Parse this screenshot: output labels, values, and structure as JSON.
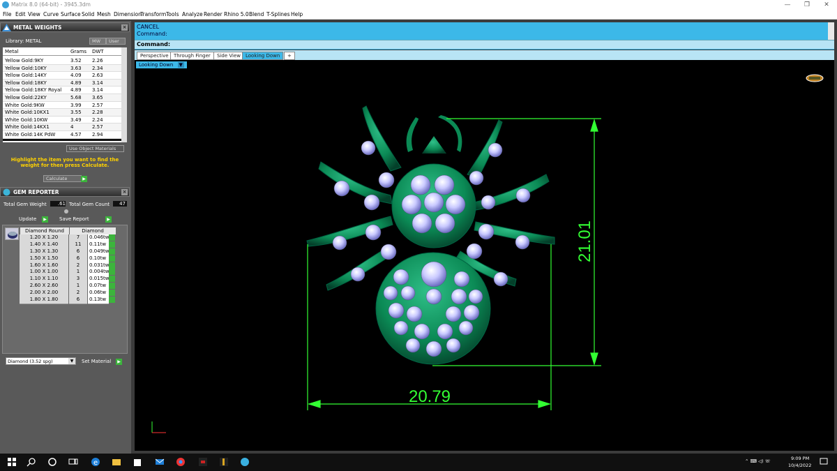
{
  "window": {
    "title": "Matrix 8.0 (64-bit) - 3945.3dm",
    "controls": [
      "—",
      "❐",
      "✕"
    ]
  },
  "menu": [
    "File",
    "Edit",
    "View",
    "Curve",
    "Surface",
    "Solid",
    "Mesh",
    "Dimension",
    "Transform",
    "Tools",
    "Analyze",
    "Render",
    "Rhino 5.0",
    "Blend",
    "T-Splines",
    "Help"
  ],
  "metal_weights": {
    "title": "METAL WEIGHTS",
    "library_label": "Library: METAL",
    "btn_mw": "MW",
    "btn_user": "User",
    "headers": [
      "Metal",
      "Grams",
      "DWT"
    ],
    "rows": [
      [
        "Yellow Gold:9KY",
        "3.52",
        "2.26"
      ],
      [
        "Yellow Gold:10KY",
        "3.63",
        "2.34"
      ],
      [
        "Yellow Gold:14KY",
        "4.09",
        "2.63"
      ],
      [
        "Yellow Gold:18KY",
        "4.89",
        "3.14"
      ],
      [
        "Yellow Gold:18KY Royal",
        "4.89",
        "3.14"
      ],
      [
        "Yellow Gold:22KY",
        "5.68",
        "3.65"
      ],
      [
        "White Gold:9KW",
        "3.99",
        "2.57"
      ],
      [
        "White Gold:10KX1",
        "3.55",
        "2.28"
      ],
      [
        "White Gold:10KW",
        "3.49",
        "2.24"
      ],
      [
        "White Gold:14KX1",
        "4",
        "2.57"
      ],
      [
        "White Gold:14K PdW",
        "4.57",
        "2.94"
      ]
    ],
    "use_object_materials": "Use Object Materials",
    "instruction": "Highlight the item you want to find the weight for then press Calculate.",
    "calculate": "Calculate"
  },
  "gem_reporter": {
    "title": "GEM REPORTER",
    "total_weight_label": "Total Gem Weight",
    "total_weight_value": ".61",
    "total_count_label": "Total Gem Count",
    "total_count_value": "47",
    "update": "Update",
    "save_report": "Save Report",
    "headers": [
      "Diamond Round",
      "Diamond"
    ],
    "rows": [
      [
        "1.20 X 1.20",
        "7",
        "0.046tw"
      ],
      [
        "1.40 X 1.40",
        "11",
        "0.11tw"
      ],
      [
        "1.30 X 1.30",
        "6",
        "0.049tw"
      ],
      [
        "1.50 X 1.50",
        "6",
        "0.10tw"
      ],
      [
        "1.60 X 1.60",
        "2",
        "0.031tw"
      ],
      [
        "1.00 X 1.00",
        "1",
        "0.004tw"
      ],
      [
        "1.10 X 1.10",
        "3",
        "0.015tw"
      ],
      [
        "2.60 X 2.60",
        "1",
        "0.07tw"
      ],
      [
        "2.00 X 2.00",
        "2",
        "0.06tw"
      ],
      [
        "1.80 X 1.80",
        "6",
        "0.13tw"
      ]
    ],
    "material_select": "Diamond    (3.52 spg)",
    "set_material": "Set Material"
  },
  "command": {
    "line1": "CANCEL",
    "line2": "Command:",
    "prompt": "Command:"
  },
  "tabs": [
    "Perspective",
    "Through Finger",
    "Side View",
    "Looking Down",
    "+"
  ],
  "active_tab": "Looking Down",
  "viewport": {
    "label": "Looking Down",
    "dim_height": "21.01",
    "dim_width": "20.79",
    "model_color": "#0e8a5a",
    "dimension_color": "#33ff33"
  },
  "taskbar": {
    "time": "9:09 PM",
    "date": "10/4/2022"
  }
}
